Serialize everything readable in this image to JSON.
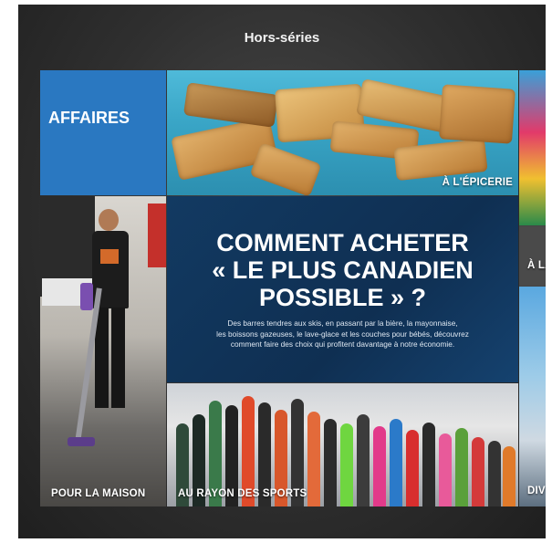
{
  "header": {
    "title": "Hors-séries"
  },
  "tiles": {
    "affaires": "AFFAIRES",
    "epicerie": "À L'ÉPICERIE",
    "maison": "POUR LA MAISON",
    "sports": "AU RAYON DES SPORTS",
    "right_top": "À LA",
    "right_bottom": "DIV"
  },
  "feature": {
    "headline_line1": "COMMENT ACHETER",
    "headline_line2": "« LE PLUS CANADIEN",
    "headline_line3": "POSSIBLE » ?",
    "sub_line1": "Des barres tendres aux skis, en passant par la bière, la mayonnaise,",
    "sub_line2": "les boissons gazeuses, le lave-glace et les couches pour bébés, découvrez",
    "sub_line3": "comment faire des choix qui profitent davantage à notre économie."
  },
  "colors": {
    "affaires_bg": "#2a78c1",
    "feature_bg": "#123a62",
    "frame_bg": "#2f2f2f"
  }
}
